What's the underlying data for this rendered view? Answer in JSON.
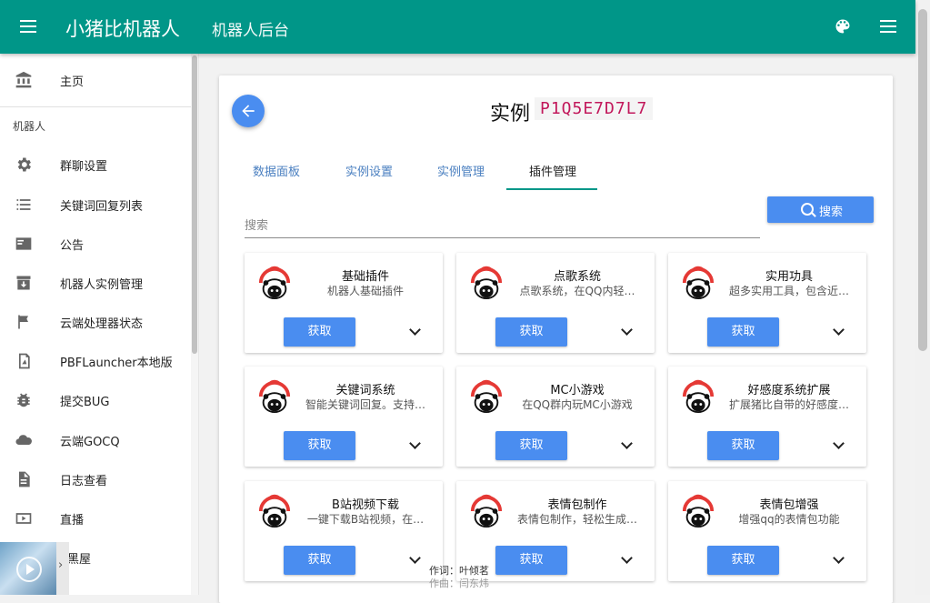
{
  "header": {
    "app_title": "小猪比机器人",
    "subtitle": "机器人后台",
    "bg_color": "#009688",
    "left_icon": "menu-icon",
    "right_icons": [
      "palette-icon",
      "menu-icon"
    ]
  },
  "sidebar": {
    "home": {
      "label": "主页",
      "icon": "bank-icon"
    },
    "section_title": "机器人",
    "items": [
      {
        "label": "群聊设置",
        "icon": "gear-icon"
      },
      {
        "label": "关键词回复列表",
        "icon": "list-icon"
      },
      {
        "label": "公告",
        "icon": "announcement-icon"
      },
      {
        "label": "机器人实例管理",
        "icon": "archive-icon"
      },
      {
        "label": "云端处理器状态",
        "icon": "flag-icon"
      },
      {
        "label": "PBFLauncher本地版",
        "icon": "app-icon"
      },
      {
        "label": "提交BUG",
        "icon": "bug-icon"
      },
      {
        "label": "云端GOCQ",
        "icon": "cloud-icon"
      },
      {
        "label": "日志查看",
        "icon": "document-icon"
      },
      {
        "label": "直播",
        "icon": "tv-icon"
      },
      {
        "label": "黑屋",
        "icon": "block-icon"
      }
    ]
  },
  "video_overlay": {
    "lyric_1": "作词：叶倾茗",
    "lyric_2": "作曲：闫东炜"
  },
  "main": {
    "title": "实例",
    "instance_code": "P1Q5E7D7L7",
    "tabs": [
      "数据面板",
      "实例设置",
      "实例管理",
      "插件管理"
    ],
    "active_tab": 3,
    "search": {
      "placeholder": "搜索",
      "button_label": "搜索"
    },
    "accent_color": "#4a8df0",
    "plugins": [
      {
        "name": "基础插件",
        "desc": "机器人基础插件",
        "button": "获取"
      },
      {
        "name": "点歌系统",
        "desc": "点歌系统，在QQ内轻…",
        "button": "获取"
      },
      {
        "name": "实用功具",
        "desc": "超多实用工具，包含近…",
        "button": "获取"
      },
      {
        "name": "关键词系统",
        "desc": "智能关键词回复。支持…",
        "button": "获取"
      },
      {
        "name": "MC小游戏",
        "desc": "在QQ群内玩MC小游戏",
        "button": "获取"
      },
      {
        "name": "好感度系统扩展",
        "desc": "扩展猪比自带的好感度…",
        "button": "获取"
      },
      {
        "name": "B站视频下载",
        "desc": "一键下载B站视频，在…",
        "button": "获取"
      },
      {
        "name": "表情包制作",
        "desc": "表情包制作，轻松生成…",
        "button": "获取"
      },
      {
        "name": "表情包增强",
        "desc": "增强qq的表情包功能",
        "button": "获取"
      }
    ]
  }
}
